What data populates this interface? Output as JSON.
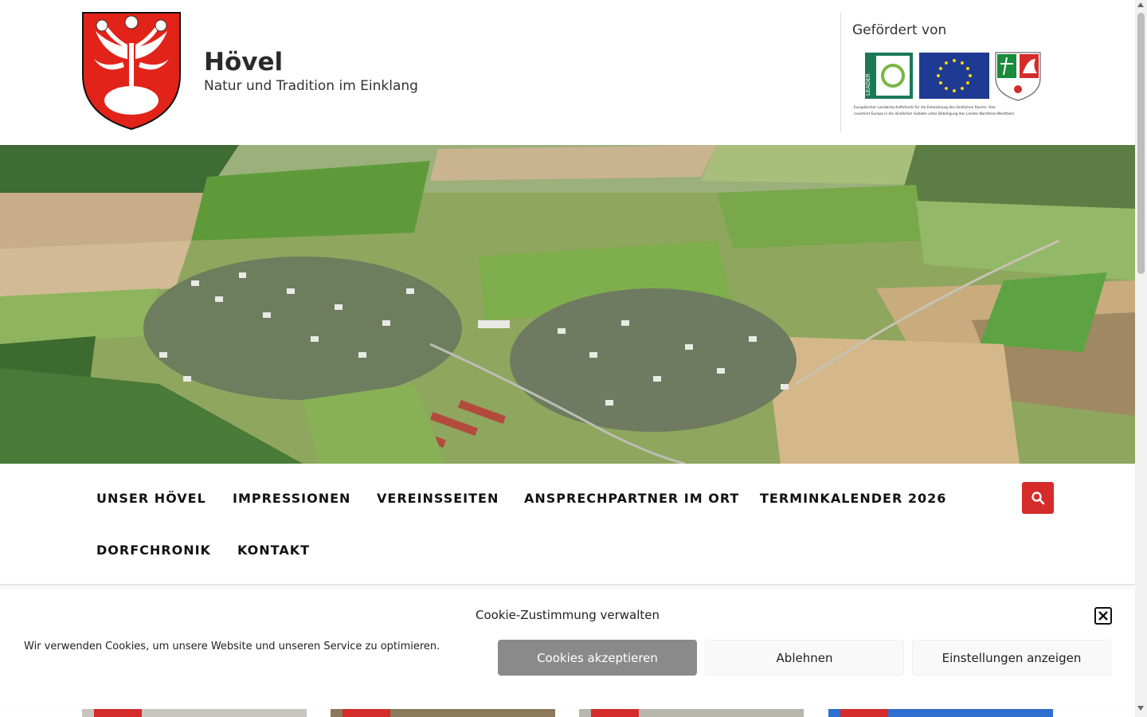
{
  "header": {
    "title": "Hövel",
    "tagline": "Natur und Tradition im Einklang",
    "sponsor_label": "Gefördert von",
    "sponsor_text_line1": "Europäischer Landwirtschaftsfonds für die Entwicklung des ländlichen Raums: Hier",
    "sponsor_text_line2": "investiert Europa in die ländlichen Gebiete unter Beteiligung des Landes Nordrhein-Westfalen",
    "leader_text": "LEADER"
  },
  "nav": {
    "items": [
      "UNSER HÖVEL",
      "IMPRESSIONEN",
      "VEREINSSEITEN",
      "ANSPRECHPARTNER IM ORT",
      "TERMINKALENDER 2026",
      "DORFCHRONIK",
      "KONTAKT"
    ],
    "search_icon": "search-icon"
  },
  "cookie": {
    "title": "Cookie-Zustimmung verwalten",
    "text": "Wir verwenden Cookies, um unsere Website und unseren Service zu optimieren.",
    "accept": "Cookies akzeptieren",
    "deny": "Ablehnen",
    "settings": "Einstellungen anzeigen",
    "close_icon": "close-icon"
  },
  "colors": {
    "accent": "#d52b2b",
    "eu_blue": "#1f3a93",
    "leader_green": "#1a7a55"
  }
}
